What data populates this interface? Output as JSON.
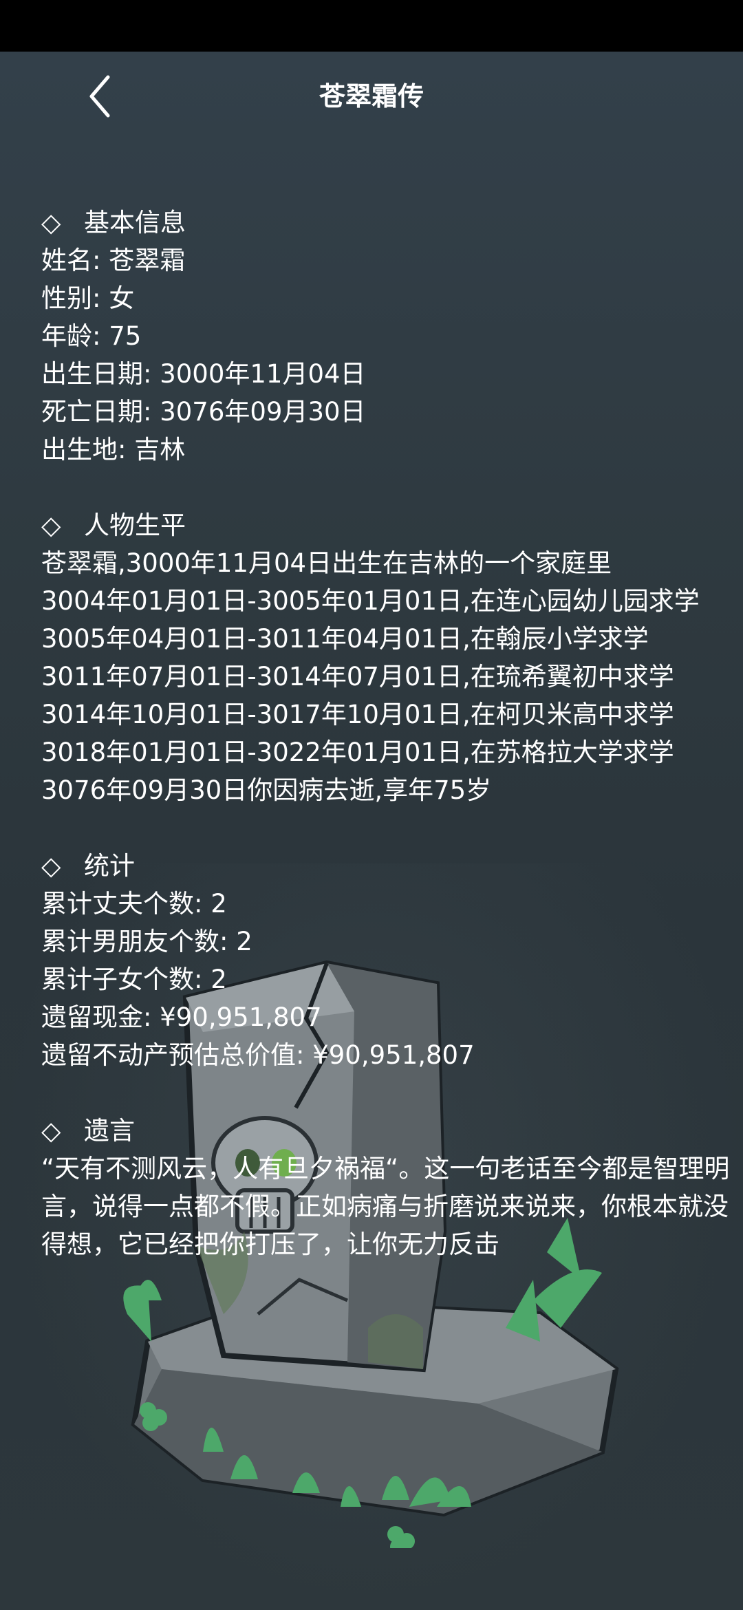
{
  "header": {
    "title": "苍翠霜传",
    "back_icon": "chevron-left-icon"
  },
  "sections": {
    "basic": {
      "marker": "◇",
      "heading": "基本信息",
      "lines": [
        "姓名: 苍翠霜",
        "性别: 女",
        "年龄: 75",
        "出生日期: 3000年11月04日",
        "死亡日期: 3076年09月30日",
        "出生地: 吉林"
      ]
    },
    "life": {
      "marker": "◇",
      "heading": "人物生平",
      "lines": [
        "苍翠霜,3000年11月04日出生在吉林的一个家庭里",
        "3004年01月01日-3005年01月01日,在连心园幼儿园求学",
        "3005年04月01日-3011年04月01日,在翰辰小学求学",
        "3011年07月01日-3014年07月01日,在琉希翼初中求学",
        "3014年10月01日-3017年10月01日,在柯贝米高中求学",
        "3018年01月01日-3022年01月01日,在苏格拉大学求学",
        "3076年09月30日你因病去逝,享年75岁"
      ]
    },
    "stats": {
      "marker": "◇",
      "heading": "统计",
      "lines": [
        "累计丈夫个数: 2",
        "累计男朋友个数: 2",
        "累计子女个数: 2",
        "遗留现金: ¥90,951,807",
        "遗留不动产预估总价值: ¥90,951,807"
      ]
    },
    "will": {
      "marker": "◇",
      "heading": "遗言",
      "text": "“天有不测风云，人有旦夕祸福“。这一句老话至今都是智理明言，说得一点都不假。正如病痛与折磨说来说来，你根本就没得想，它已经把你打压了，让你无力反击"
    }
  },
  "illustration": {
    "name": "tombstone-illustration",
    "colors": {
      "stone": "#8a9095",
      "stone_dark": "#4e5559",
      "outline": "#1c2226",
      "grass": "#4da86a",
      "moss": "#5f7a55"
    }
  }
}
